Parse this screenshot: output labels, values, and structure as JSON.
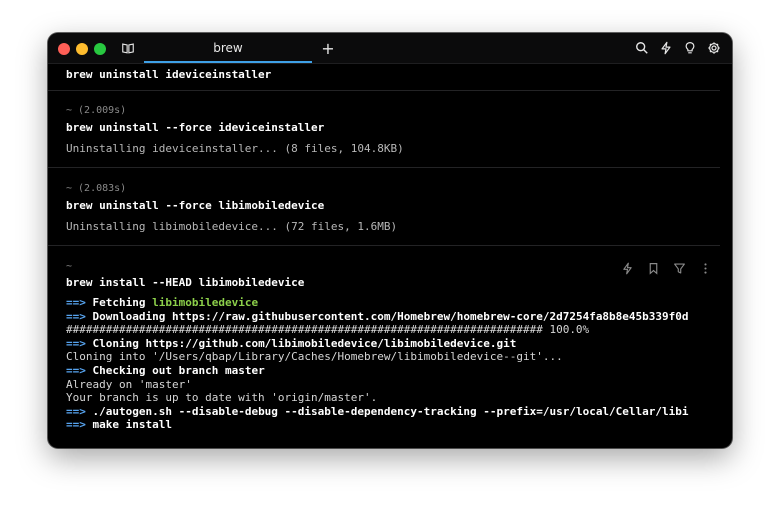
{
  "window": {
    "tab_title": "brew",
    "new_tab_label": "+"
  },
  "blocks": [
    {
      "command": "brew uninstall ideviceinstaller"
    },
    {
      "duration": "~ (2.009s)",
      "command": "brew uninstall --force ideviceinstaller",
      "output": "Uninstalling ideviceinstaller... (8 files, 104.8KB)"
    },
    {
      "duration": "~ (2.083s)",
      "command": "brew uninstall --force libimobiledevice",
      "output": "Uninstalling libimobiledevice... (72 files, 1.6MB)"
    }
  ],
  "active_block": {
    "prompt": "~",
    "command": "brew install --HEAD libimobiledevice",
    "lines": [
      {
        "arrow": "==>",
        "bold": "Fetching ",
        "green": "libimobiledevice"
      },
      {
        "arrow": "==>",
        "bold": "Downloading https://raw.githubusercontent.com/Homebrew/homebrew-core/2d7254fa8b8e45b339f0d"
      },
      {
        "plain": "######################################################################## 100.0%"
      },
      {
        "arrow": "==>",
        "bold": "Cloning https://github.com/libimobiledevice/libimobiledevice.git"
      },
      {
        "plain": "Cloning into '/Users/qbap/Library/Caches/Homebrew/libimobiledevice--git'..."
      },
      {
        "arrow": "==>",
        "bold": "Checking out branch master"
      },
      {
        "plain": "Already on 'master'"
      },
      {
        "plain": "Your branch is up to date with 'origin/master'."
      },
      {
        "arrow": "==>",
        "bold": "./autogen.sh --disable-debug --disable-dependency-tracking --prefix=/usr/local/Cellar/libi"
      },
      {
        "arrow": "==>",
        "bold": "make install"
      }
    ]
  },
  "icons": {
    "titlebar_left": "book-icon",
    "titlebar_right": [
      "search-icon",
      "bolt-icon",
      "lightbulb-icon",
      "gear-icon"
    ],
    "block_actions": [
      "bolt-icon",
      "bookmark-icon",
      "filter-icon",
      "more-vertical-icon"
    ]
  },
  "colors": {
    "accent": "#3ea0e6",
    "arrow": "#57a4f0",
    "highlight_green": "#8ccf4a",
    "cursor": "#4fb6e8"
  }
}
